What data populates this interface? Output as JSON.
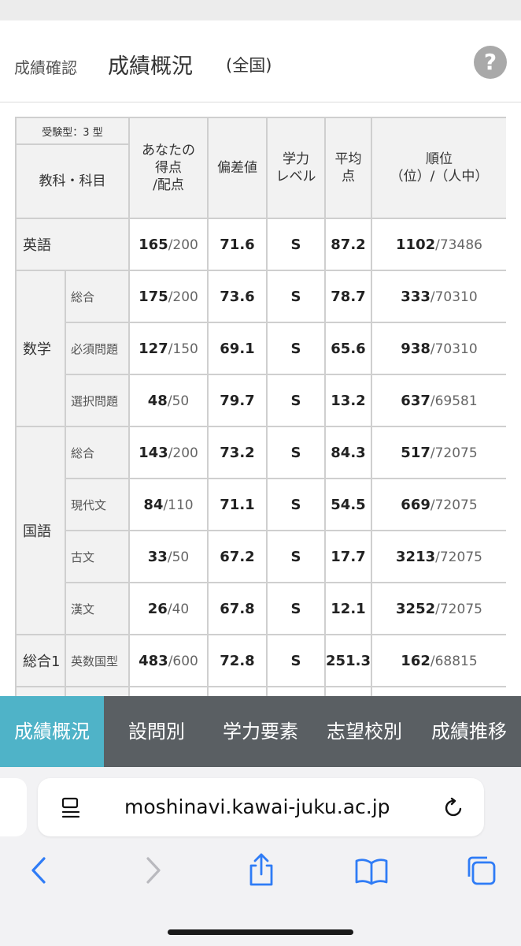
{
  "header": {
    "breadcrumb": "成績確認",
    "title": "成績概況",
    "subtitle": "(全国)",
    "help_symbol": "?"
  },
  "table": {
    "exam_type": "受験型：3 型",
    "col_subject": "教科・科目",
    "col_score_1": "あなたの",
    "col_score_2": "得点",
    "col_score_3": "/配点",
    "col_deviation": "偏差値",
    "col_level_1": "学力",
    "col_level_2": "レベル",
    "col_average_1": "平均",
    "col_average_2": "点",
    "col_rank_1": "順位",
    "col_rank_2": "（位）/（人中）",
    "rows": [
      {
        "group": "英語",
        "sub": "",
        "score": "165",
        "max": "/200",
        "deviation": "71.6",
        "level": "S",
        "average": "87.2",
        "rank": "1102",
        "total": "/73486"
      },
      {
        "group": "数学",
        "sub": "総合",
        "score": "175",
        "max": "/200",
        "deviation": "73.6",
        "level": "S",
        "average": "78.7",
        "rank": "333",
        "total": "/70310"
      },
      {
        "group": "",
        "sub": "必須問題",
        "score": "127",
        "max": "/150",
        "deviation": "69.1",
        "level": "S",
        "average": "65.6",
        "rank": "938",
        "total": "/70310"
      },
      {
        "group": "",
        "sub": "選択問題",
        "score": "48",
        "max": "/50",
        "deviation": "79.7",
        "level": "S",
        "average": "13.2",
        "rank": "637",
        "total": "/69581"
      },
      {
        "group": "国語",
        "sub": "総合",
        "score": "143",
        "max": "/200",
        "deviation": "73.2",
        "level": "S",
        "average": "84.3",
        "rank": "517",
        "total": "/72075"
      },
      {
        "group": "",
        "sub": "現代文",
        "score": "84",
        "max": "/110",
        "deviation": "71.1",
        "level": "S",
        "average": "54.5",
        "rank": "669",
        "total": "/72075"
      },
      {
        "group": "",
        "sub": "古文",
        "score": "33",
        "max": "/50",
        "deviation": "67.2",
        "level": "S",
        "average": "17.7",
        "rank": "3213",
        "total": "/72075"
      },
      {
        "group": "",
        "sub": "漢文",
        "score": "26",
        "max": "/40",
        "deviation": "67.8",
        "level": "S",
        "average": "12.1",
        "rank": "3252",
        "total": "/72075"
      },
      {
        "group": "総合1",
        "sub": "英数国型",
        "score": "483",
        "max": "/600",
        "deviation": "72.8",
        "level": "S",
        "average": "251.3",
        "rank": "162",
        "total": "/68815"
      }
    ]
  },
  "tabs": [
    {
      "label": "成績概況",
      "active": true
    },
    {
      "label": "設問別",
      "active": false
    },
    {
      "label": "学力要素",
      "active": false
    },
    {
      "label": "志望校別",
      "active": false
    },
    {
      "label": "成績推移",
      "active": false
    }
  ],
  "browser": {
    "url": "moshinavi.kawai-juku.ac.jp",
    "accent": "#2f7cf6"
  }
}
